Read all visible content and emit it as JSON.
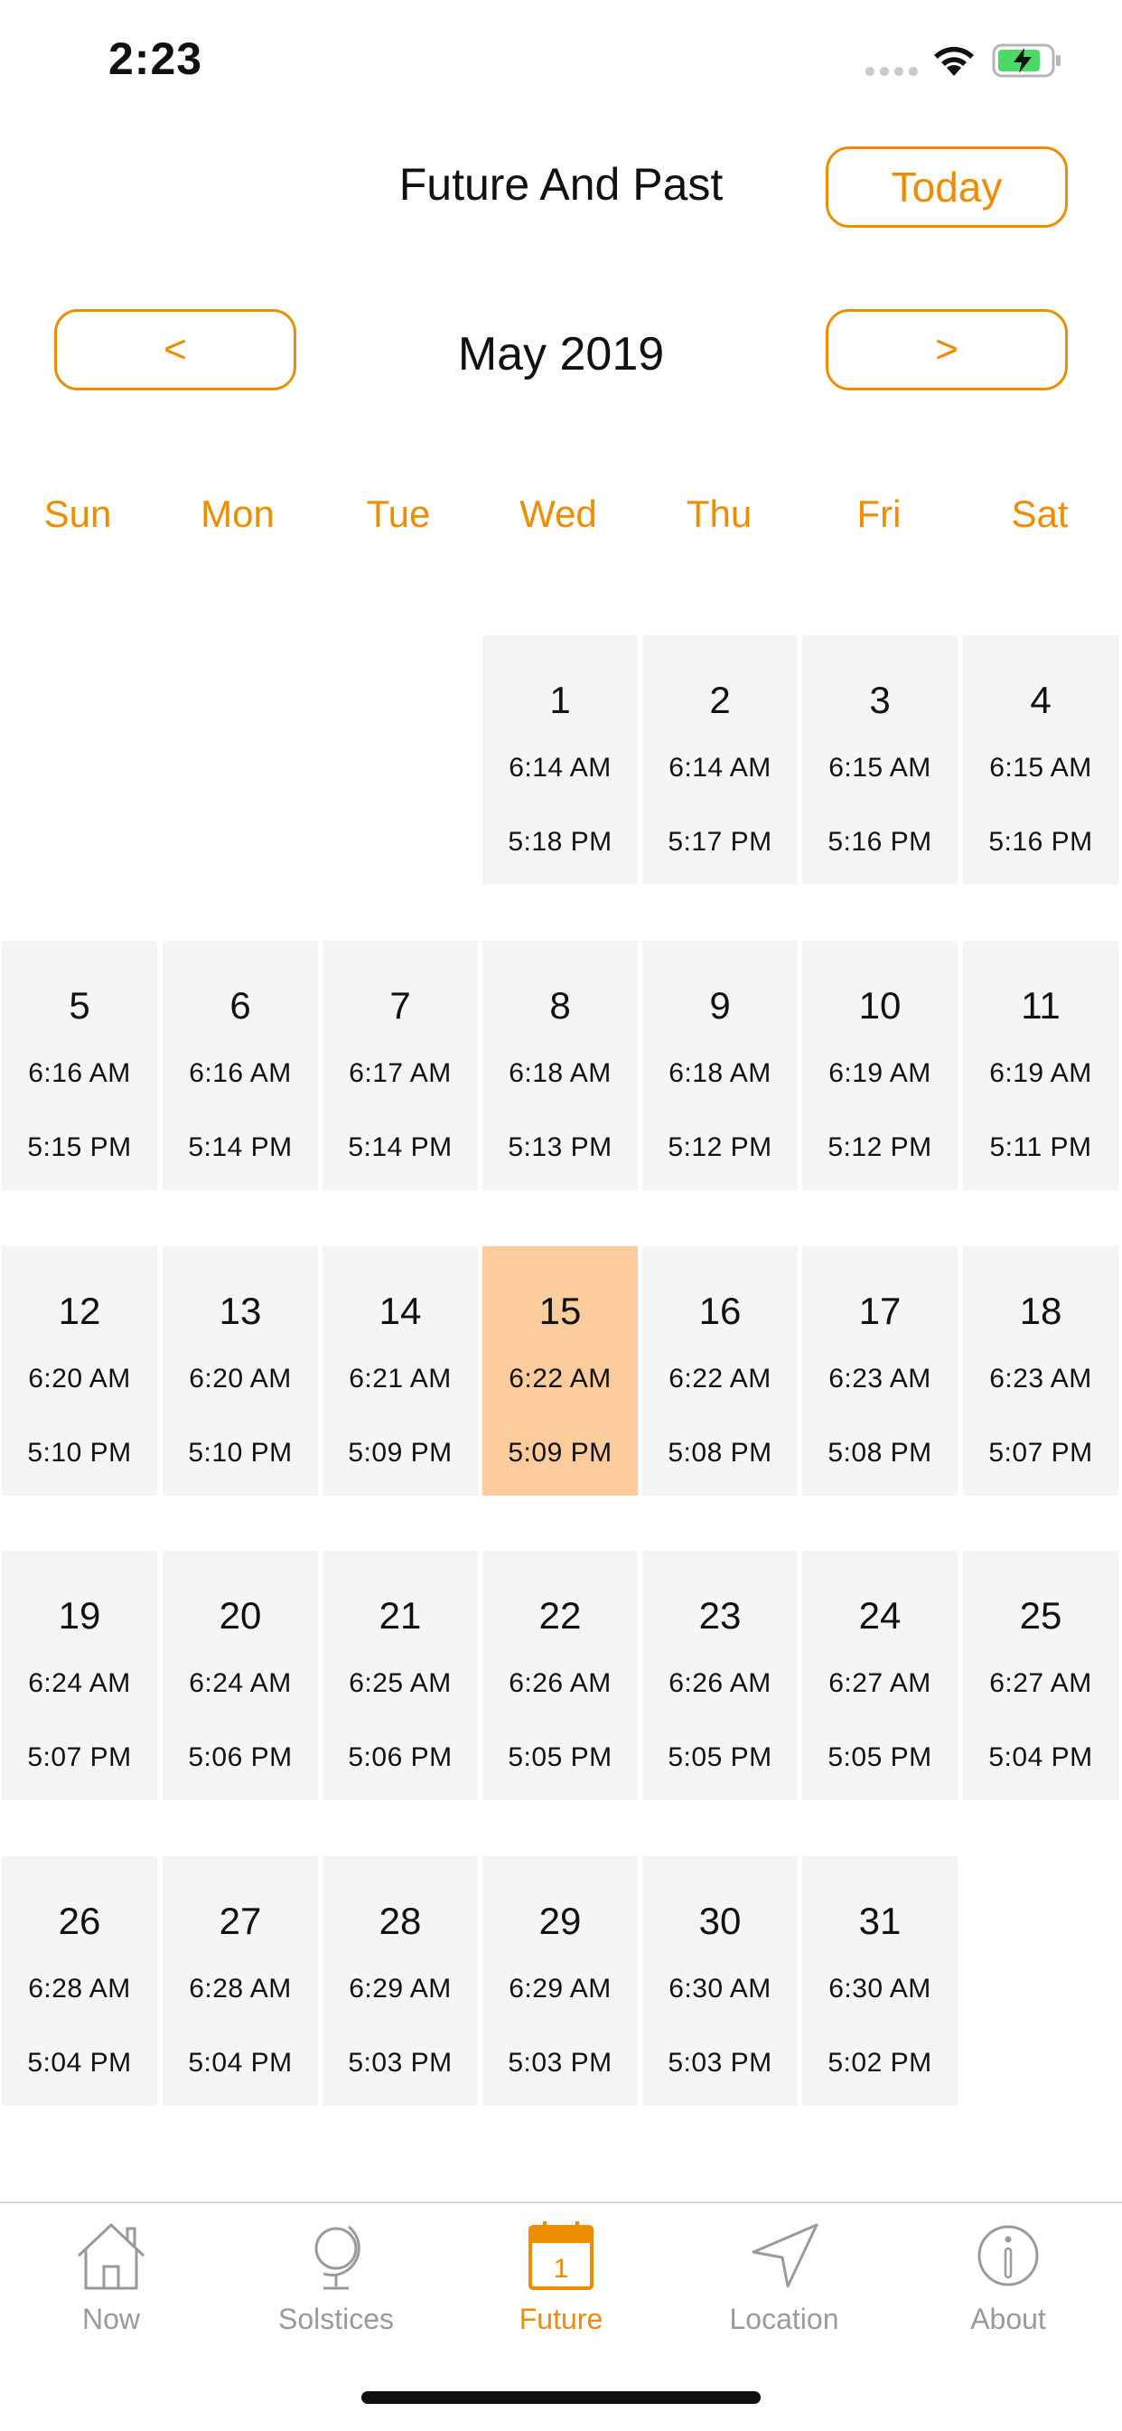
{
  "status_bar": {
    "time": "2:23"
  },
  "header": {
    "title": "Future And Past",
    "today_button": "Today"
  },
  "navigation": {
    "prev_label": "<",
    "next_label": ">",
    "month": "May 2019"
  },
  "weekdays": [
    "Sun",
    "Mon",
    "Tue",
    "Wed",
    "Thu",
    "Fri",
    "Sat"
  ],
  "calendar": {
    "first_weekday_index": 3,
    "selected_day": 15,
    "days": [
      {
        "day": "1",
        "sunrise": "6:14 AM",
        "sunset": "5:18 PM"
      },
      {
        "day": "2",
        "sunrise": "6:14 AM",
        "sunset": "5:17 PM"
      },
      {
        "day": "3",
        "sunrise": "6:15 AM",
        "sunset": "5:16 PM"
      },
      {
        "day": "4",
        "sunrise": "6:15 AM",
        "sunset": "5:16 PM"
      },
      {
        "day": "5",
        "sunrise": "6:16 AM",
        "sunset": "5:15 PM"
      },
      {
        "day": "6",
        "sunrise": "6:16 AM",
        "sunset": "5:14 PM"
      },
      {
        "day": "7",
        "sunrise": "6:17 AM",
        "sunset": "5:14 PM"
      },
      {
        "day": "8",
        "sunrise": "6:18 AM",
        "sunset": "5:13 PM"
      },
      {
        "day": "9",
        "sunrise": "6:18 AM",
        "sunset": "5:12 PM"
      },
      {
        "day": "10",
        "sunrise": "6:19 AM",
        "sunset": "5:12 PM"
      },
      {
        "day": "11",
        "sunrise": "6:19 AM",
        "sunset": "5:11 PM"
      },
      {
        "day": "12",
        "sunrise": "6:20 AM",
        "sunset": "5:10 PM"
      },
      {
        "day": "13",
        "sunrise": "6:20 AM",
        "sunset": "5:10 PM"
      },
      {
        "day": "14",
        "sunrise": "6:21 AM",
        "sunset": "5:09 PM"
      },
      {
        "day": "15",
        "sunrise": "6:22 AM",
        "sunset": "5:09 PM"
      },
      {
        "day": "16",
        "sunrise": "6:22 AM",
        "sunset": "5:08 PM"
      },
      {
        "day": "17",
        "sunrise": "6:23 AM",
        "sunset": "5:08 PM"
      },
      {
        "day": "18",
        "sunrise": "6:23 AM",
        "sunset": "5:07 PM"
      },
      {
        "day": "19",
        "sunrise": "6:24 AM",
        "sunset": "5:07 PM"
      },
      {
        "day": "20",
        "sunrise": "6:24 AM",
        "sunset": "5:06 PM"
      },
      {
        "day": "21",
        "sunrise": "6:25 AM",
        "sunset": "5:06 PM"
      },
      {
        "day": "22",
        "sunrise": "6:26 AM",
        "sunset": "5:05 PM"
      },
      {
        "day": "23",
        "sunrise": "6:26 AM",
        "sunset": "5:05 PM"
      },
      {
        "day": "24",
        "sunrise": "6:27 AM",
        "sunset": "5:05 PM"
      },
      {
        "day": "25",
        "sunrise": "6:27 AM",
        "sunset": "5:04 PM"
      },
      {
        "day": "26",
        "sunrise": "6:28 AM",
        "sunset": "5:04 PM"
      },
      {
        "day": "27",
        "sunrise": "6:28 AM",
        "sunset": "5:04 PM"
      },
      {
        "day": "28",
        "sunrise": "6:29 AM",
        "sunset": "5:03 PM"
      },
      {
        "day": "29",
        "sunrise": "6:29 AM",
        "sunset": "5:03 PM"
      },
      {
        "day": "30",
        "sunrise": "6:30 AM",
        "sunset": "5:03 PM"
      },
      {
        "day": "31",
        "sunrise": "6:30 AM",
        "sunset": "5:02 PM"
      }
    ]
  },
  "tabbar": {
    "items": [
      {
        "label": "Now",
        "icon": "home-icon"
      },
      {
        "label": "Solstices",
        "icon": "globe-icon"
      },
      {
        "label": "Future",
        "icon": "calendar-icon",
        "badge": "1"
      },
      {
        "label": "Location",
        "icon": "location-arrow-icon"
      },
      {
        "label": "About",
        "icon": "info-icon"
      }
    ],
    "active_index": 2
  },
  "colors": {
    "accent": "#f08c00",
    "cell_background": "#f5f5f5",
    "selected_cell_background": "#fdcc9c",
    "tab_inactive": "#9a9a9a"
  }
}
